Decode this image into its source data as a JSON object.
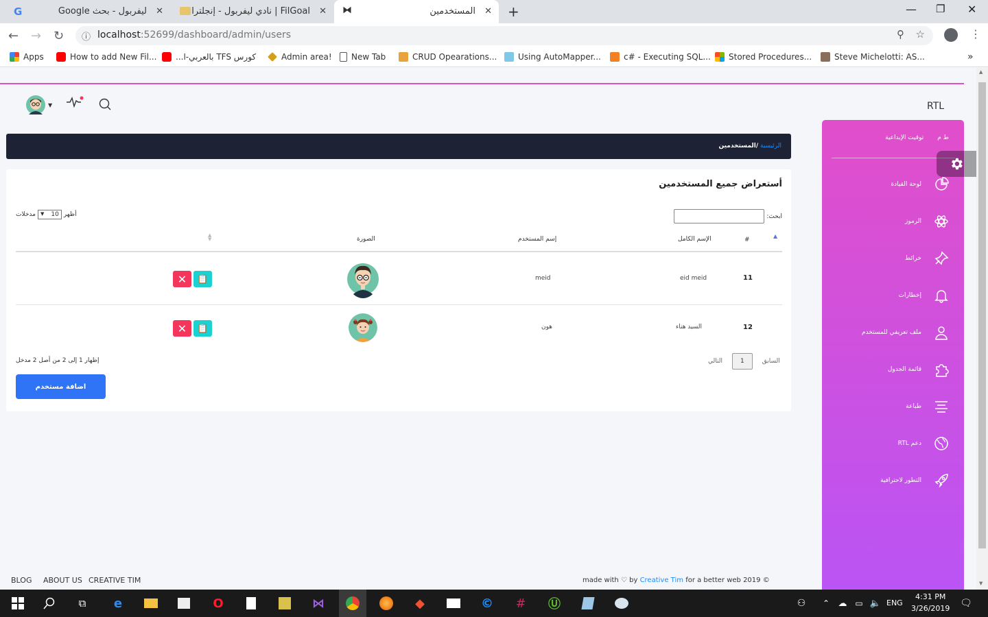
{
  "browser": {
    "tabs": [
      {
        "title": "ليفربول - بحث Google"
      },
      {
        "title": "FilGoal | نادي ليفربول - إنجلترا"
      },
      {
        "title": "المستخدمين"
      }
    ],
    "url_host": "localhost",
    "url_path": ":52699/dashboard/admin/users",
    "bookmarks": [
      "Apps",
      "How to add New Fil...",
      "كورس TFS بالعربي-ا...",
      "Admin area!",
      "New Tab",
      "CRUD Opearations...",
      "Using AutoMapper...",
      "c# - Executing SQL...",
      "Stored Procedures...",
      "Steve Michelotti: AS..."
    ]
  },
  "topnav": {
    "rtl_label": "RTL"
  },
  "sidebar": {
    "header_short": "ط م",
    "header_title": "توقيت الإبداعية",
    "items": [
      {
        "label": "لوحة القيادة",
        "icon": "chart-pie-icon"
      },
      {
        "label": "الرموز",
        "icon": "atom-icon"
      },
      {
        "label": "خرائط",
        "icon": "pin-icon"
      },
      {
        "label": "إخطارات",
        "icon": "bell-icon"
      },
      {
        "label": "ملف تعريفي للمستخدم",
        "icon": "user-icon"
      },
      {
        "label": "قائمة الجدول",
        "icon": "puzzle-icon"
      },
      {
        "label": "طباعة",
        "icon": "align-center-icon"
      },
      {
        "label": "دعم RTL",
        "icon": "world-icon"
      },
      {
        "label": "التطور لاحترافية",
        "icon": "rocket-icon"
      }
    ]
  },
  "breadcrumb": {
    "home": "الرئيسية",
    "current": "/المستخدمين"
  },
  "card": {
    "title": "أستعراض جميع المستخدمين",
    "show_label": "أظهر",
    "show_value": "10",
    "entries_label": "مدخلات",
    "search_label": "ابحث:",
    "columns": [
      "#",
      "الإسم الكامل",
      "إسم المستخدم",
      "الصورة"
    ],
    "rows": [
      {
        "id": "11",
        "full_name": "eid meid",
        "username": "meid"
      },
      {
        "id": "12",
        "full_name": "السيد هناء",
        "username": "هون"
      }
    ],
    "info": "إظهار 1 إلى 2 من أصل 2 مدخل",
    "prev": "السابق",
    "page": "1",
    "next": "التالي",
    "add_button": "اضافة مستخدم"
  },
  "footer": {
    "links": [
      "BLOG",
      "ABOUT US",
      "CREATIVE TIM"
    ],
    "copyright_pre": "made with",
    "copyright_by": "by",
    "copyright_brand": "Creative Tim",
    "copyright_post": "for a better web 2019 ©"
  },
  "taskbar": {
    "language": "ENG",
    "time": "4:31 PM",
    "date": "3/26/2019"
  },
  "colors": {
    "sidebar_start": "#e14eca",
    "sidebar_end": "#ba54f5",
    "breadcrumb_bg": "#1e2235",
    "add_button": "#2f73f7",
    "delete": "#f5365c",
    "edit": "#1cd1d1"
  }
}
